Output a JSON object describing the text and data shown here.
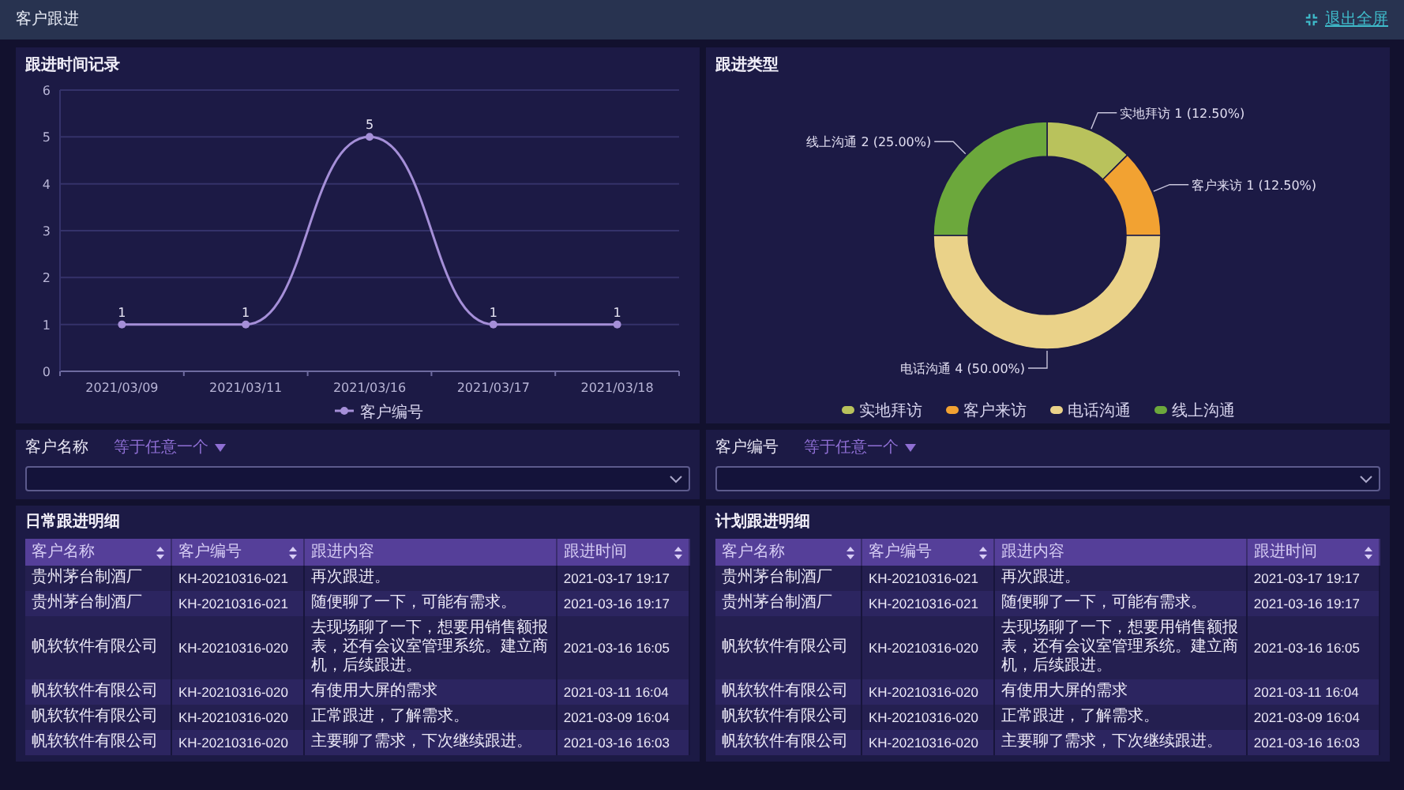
{
  "header": {
    "title": "客户跟进",
    "exit_button": "退出全屏"
  },
  "timeline_panel": {
    "title": "跟进时间记录",
    "chart_data": {
      "type": "line",
      "categories": [
        "2021/03/09",
        "2021/03/11",
        "2021/03/16",
        "2021/03/17",
        "2021/03/18"
      ],
      "series": [
        {
          "name": "客户编号",
          "color": "#a58fd8",
          "values": [
            1,
            1,
            5,
            1,
            1
          ],
          "marker": true
        }
      ],
      "ylim": [
        0,
        6
      ],
      "yticks": [
        0,
        1,
        2,
        3,
        4,
        5,
        6
      ],
      "data_labels": true,
      "grid": true,
      "legend": true
    }
  },
  "type_panel": {
    "title": "跟进类型",
    "chart_data": {
      "type": "donut",
      "categories": [
        "实地拜访",
        "客户来访",
        "电话沟通",
        "线上沟通"
      ],
      "values": [
        1,
        1,
        4,
        2
      ],
      "legend": true,
      "colors": [
        "#b9c25c",
        "#f2a232",
        "#ead289",
        "#6ca83c"
      ],
      "value_labels": [
        "实地拜访 1 (12.50%)",
        "客户来访 1 (12.50%)",
        "电话沟通 4 (50.00%)",
        "线上沟通 2 (25.00%)"
      ]
    }
  },
  "filters": [
    {
      "label": "客户名称",
      "operator": "等于任意一个"
    },
    {
      "label": "客户编号",
      "operator": "等于任意一个"
    }
  ],
  "tables": [
    {
      "title": "日常跟进明细",
      "columns": [
        {
          "label": "客户名称",
          "sortable": true
        },
        {
          "label": "客户编号",
          "sortable": true
        },
        {
          "label": "跟进内容",
          "sortable": false
        },
        {
          "label": "跟进时间",
          "sortable": true
        }
      ],
      "rows": [
        [
          "贵州茅台制酒厂",
          "KH-20210316-021",
          "再次跟进。",
          "2021-03-17 19:17"
        ],
        [
          "贵州茅台制酒厂",
          "KH-20210316-021",
          "随便聊了一下，可能有需求。",
          "2021-03-16 19:17"
        ],
        [
          "帆软软件有限公司",
          "KH-20210316-020",
          "去现场聊了一下，想要用销售额报表，还有会议室管理系统。建立商机，后续跟进。",
          "2021-03-16 16:05"
        ],
        [
          "帆软软件有限公司",
          "KH-20210316-020",
          "有使用大屏的需求",
          "2021-03-11 16:04"
        ],
        [
          "帆软软件有限公司",
          "KH-20210316-020",
          "正常跟进，了解需求。",
          "2021-03-09 16:04"
        ],
        [
          "帆软软件有限公司",
          "KH-20210316-020",
          "主要聊了需求，下次继续跟进。",
          "2021-03-16 16:03"
        ]
      ]
    },
    {
      "title": "计划跟进明细",
      "columns": [
        {
          "label": "客户名称",
          "sortable": true
        },
        {
          "label": "客户编号",
          "sortable": true
        },
        {
          "label": "跟进内容",
          "sortable": false
        },
        {
          "label": "跟进时间",
          "sortable": true
        }
      ],
      "rows": [
        [
          "贵州茅台制酒厂",
          "KH-20210316-021",
          "再次跟进。",
          "2021-03-17 19:17"
        ],
        [
          "贵州茅台制酒厂",
          "KH-20210316-021",
          "随便聊了一下，可能有需求。",
          "2021-03-16 19:17"
        ],
        [
          "帆软软件有限公司",
          "KH-20210316-020",
          "去现场聊了一下，想要用销售额报表，还有会议室管理系统。建立商机，后续跟进。",
          "2021-03-16 16:05"
        ],
        [
          "帆软软件有限公司",
          "KH-20210316-020",
          "有使用大屏的需求",
          "2021-03-11 16:04"
        ],
        [
          "帆软软件有限公司",
          "KH-20210316-020",
          "正常跟进，了解需求。",
          "2021-03-09 16:04"
        ],
        [
          "帆软软件有限公司",
          "KH-20210316-020",
          "主要聊了需求，下次继续跟进。",
          "2021-03-16 16:03"
        ]
      ]
    }
  ]
}
